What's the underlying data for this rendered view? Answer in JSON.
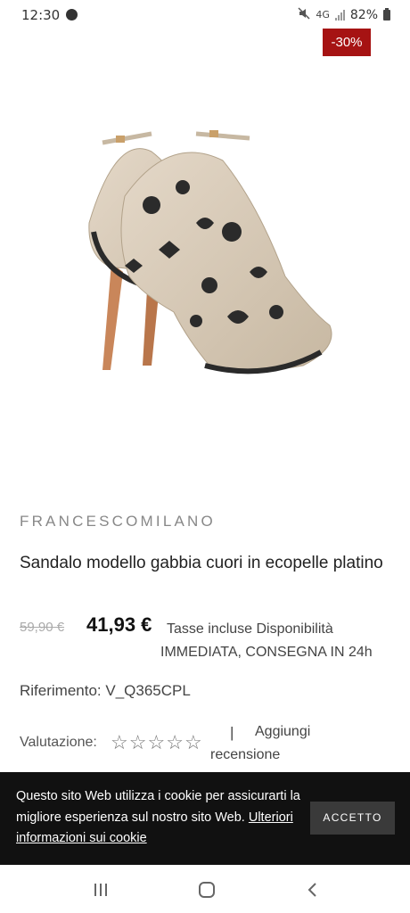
{
  "status_bar": {
    "time": "12:30",
    "network": "4G",
    "battery": "82%"
  },
  "product": {
    "discount_badge": "-30%",
    "image_alt": "sandal",
    "brand": "FRANCESCOMILANO",
    "title": "Sandalo modello gabbia cuori in ecopelle platino",
    "old_price": "59,90 €",
    "price": "41,93 €",
    "tax_line1": "Tasse incluse Disponibilità",
    "tax_line2": "IMMEDIATA, CONSEGNA IN 24h",
    "reference": "Riferimento: V_Q365CPL",
    "rating_label": "Valutazione:",
    "rating_separator": "|",
    "add_review_line1": "Aggiungi",
    "add_review_line2": "recensione"
  },
  "cookie_banner": {
    "text": "Questo sito Web utilizza i cookie per assicurarti la migliore esperienza sul nostro sito Web.",
    "link": "Ulteriori informazioni sui cookie",
    "accept_button": "ACCETTO"
  },
  "colors": {
    "badge": "#a61313",
    "banner": "#111111",
    "button": "#3a3a3a"
  },
  "icons": {
    "stars": [
      "star-outline-icon",
      "star-outline-icon",
      "star-outline-icon",
      "star-outline-icon",
      "star-outline-icon"
    ],
    "nav": [
      "recent-apps-icon",
      "home-icon",
      "back-icon"
    ]
  }
}
